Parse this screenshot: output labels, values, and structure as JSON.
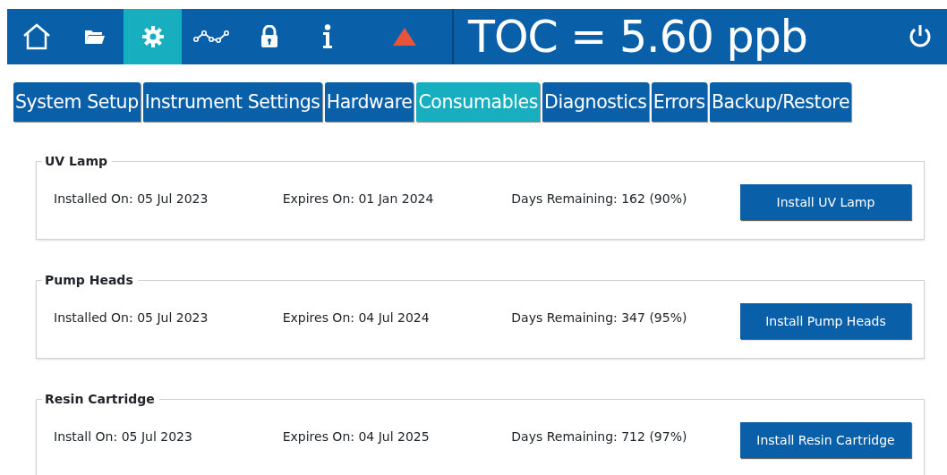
{
  "nav_icons": [
    {
      "kind": "home",
      "selected": false
    },
    {
      "kind": "folder",
      "selected": false
    },
    {
      "kind": "gear",
      "selected": true
    },
    {
      "kind": "graph",
      "selected": false
    },
    {
      "kind": "lock",
      "selected": false
    },
    {
      "kind": "info",
      "selected": false
    },
    {
      "kind": "warning",
      "selected": false
    }
  ],
  "reading": "TOC = 5.60 ppb",
  "tabs": [
    {
      "label": "System Setup",
      "selected": false
    },
    {
      "label": "Instrument Settings",
      "selected": false
    },
    {
      "label": "Hardware",
      "selected": false
    },
    {
      "label": "Consumables",
      "selected": true
    },
    {
      "label": "Diagnostics",
      "selected": false
    },
    {
      "label": "Errors",
      "selected": false
    },
    {
      "label": "Backup/Restore",
      "selected": false
    }
  ],
  "consumables": [
    {
      "title": "UV Lamp",
      "installed": "Installed On: 05 Jul 2023",
      "expires": "Expires On: 01 Jan 2024",
      "remaining": "Days Remaining: 162 (90%)",
      "button": "Install UV Lamp"
    },
    {
      "title": "Pump Heads",
      "installed": "Installed On: 05 Jul 2023",
      "expires": "Expires On: 04 Jul 2024",
      "remaining": "Days Remaining: 347 (95%)",
      "button": "Install Pump Heads"
    },
    {
      "title": "Resin Cartridge",
      "installed": "Install On: 05 Jul 2023",
      "expires": "Expires On: 04 Jul 2025",
      "remaining": "Days Remaining: 712 (97%)",
      "button": "Install Resin Cartridge"
    }
  ]
}
